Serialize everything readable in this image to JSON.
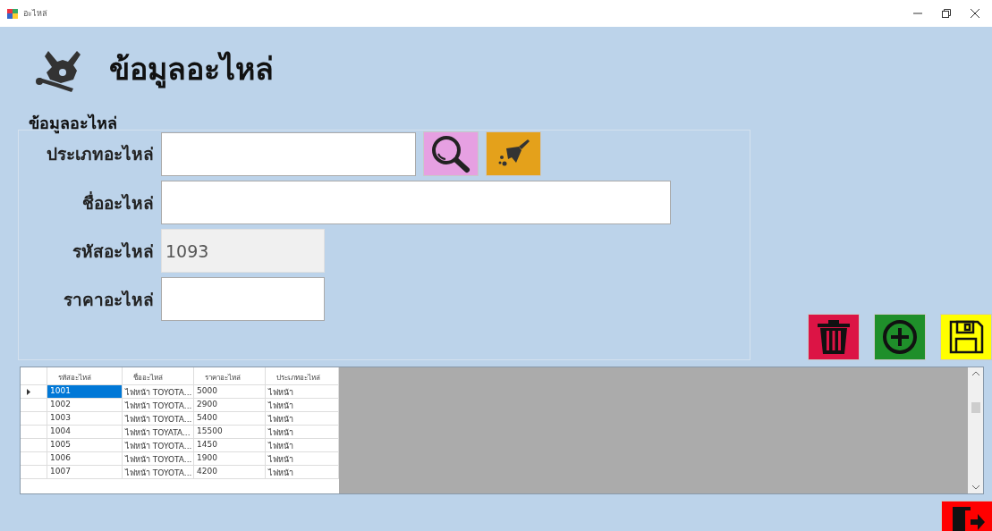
{
  "window": {
    "title": "อะไหล่"
  },
  "heading": "ข้อมูลอะไหล่",
  "group": {
    "legend": "ข้อมูลอะไหล่",
    "fields": [
      {
        "label": "ประเภทอะไหล่",
        "disabled": false
      },
      {
        "label": "ชื่ออะไหล่",
        "disabled": false
      },
      {
        "label": "รหัสอะไหล่",
        "value": "1093",
        "disabled": true
      },
      {
        "label": "ราคาอะไหล่",
        "disabled": false
      }
    ],
    "field_buttons": [
      {
        "kind": "search"
      },
      {
        "kind": "clear"
      }
    ]
  },
  "actions": [
    {
      "kind": "delete"
    },
    {
      "kind": "add"
    },
    {
      "kind": "save"
    }
  ],
  "table": {
    "columns": [
      "รหัสอะไหล่",
      "ชื่ออะไหล่",
      "ราคาอะไหล่",
      "ประเภทอะไหล่"
    ],
    "rows": [
      {
        "selected": true,
        "cells": [
          "1001",
          "ไฟหน้า TOYOTA...",
          "5000",
          "ไฟหน้า"
        ]
      },
      {
        "selected": false,
        "cells": [
          "1002",
          "ไฟหน้า TOYOTA...",
          "2900",
          "ไฟหน้า"
        ]
      },
      {
        "selected": false,
        "cells": [
          "1003",
          "ไฟหน้า TOYOTA...",
          "5400",
          "ไฟหน้า"
        ]
      },
      {
        "selected": false,
        "cells": [
          "1004",
          "ไฟหน้า TOYATA...",
          "15500",
          "ไฟหน้า"
        ]
      },
      {
        "selected": false,
        "cells": [
          "1005",
          "ไฟหน้า TOYOTA...",
          "1450",
          "ไฟหน้า"
        ]
      },
      {
        "selected": false,
        "cells": [
          "1006",
          "ไฟหน้า TOYOTA...",
          "1900",
          "ไฟหน้า"
        ]
      },
      {
        "selected": false,
        "cells": [
          "1007",
          "ไฟหน้า TOYOTA...",
          "4200",
          "ไฟหน้า"
        ]
      }
    ]
  },
  "exit": {
    "kind": "exit"
  }
}
